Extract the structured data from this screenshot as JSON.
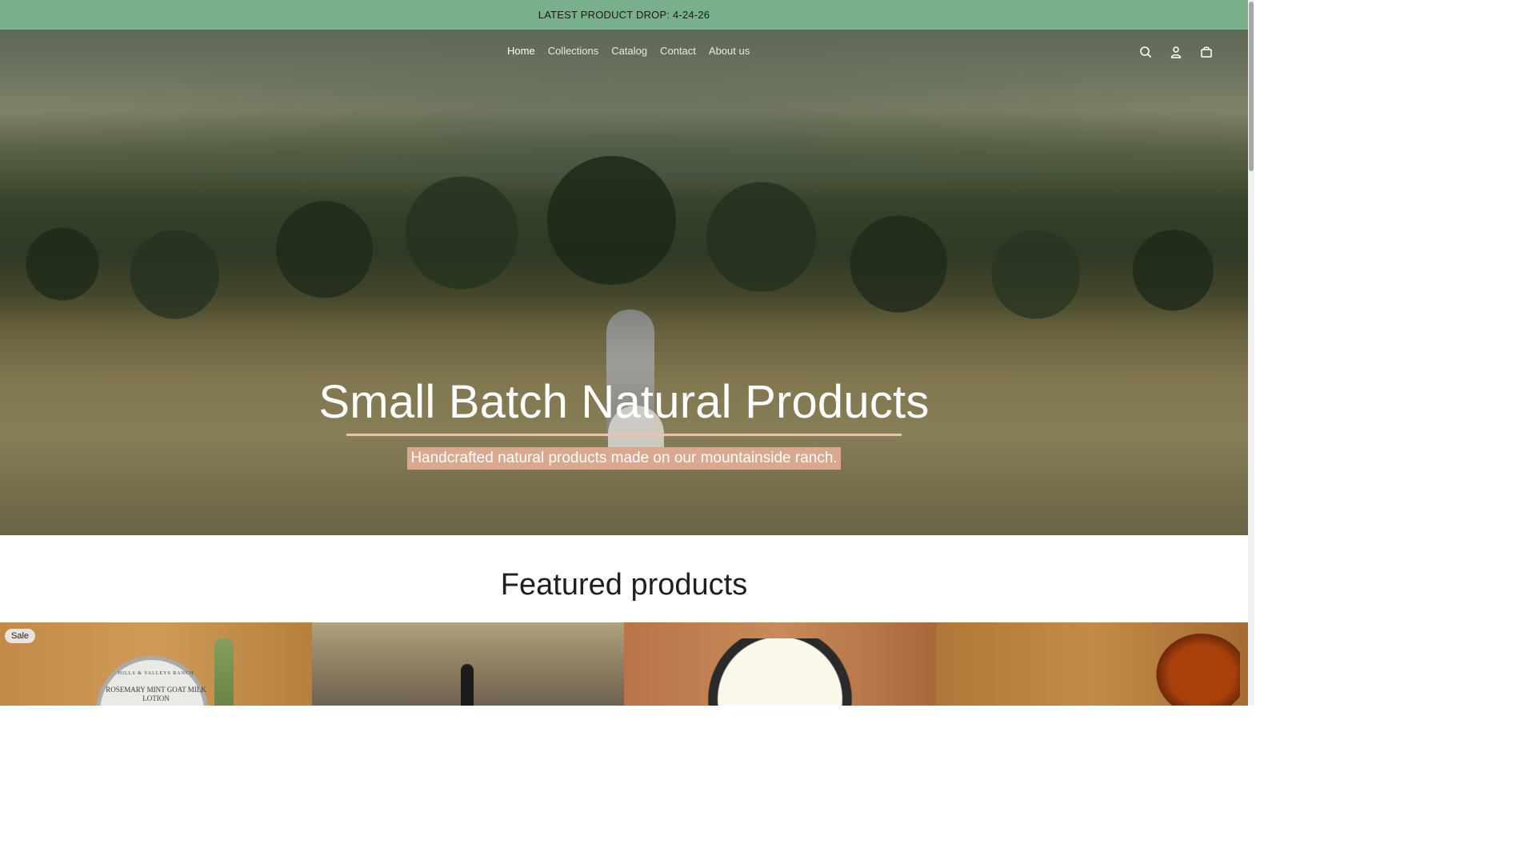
{
  "announcement": {
    "text": "LATEST PRODUCT DROP: 4-24-26"
  },
  "nav": {
    "items": [
      {
        "label": "Home",
        "active": true
      },
      {
        "label": "Collections",
        "active": false
      },
      {
        "label": "Catalog",
        "active": false
      },
      {
        "label": "Contact",
        "active": false
      },
      {
        "label": "About us",
        "active": false
      }
    ]
  },
  "header_icons": [
    "search-icon",
    "account-icon",
    "cart-icon"
  ],
  "hero": {
    "title": "Small Batch Natural Products",
    "subtitle": "Handcrafted natural products made on our mountainside ranch."
  },
  "featured": {
    "title": "Featured products",
    "products": [
      {
        "badge": "Sale",
        "label_small": "HILLS & VALLEYS RANCH",
        "label_main": "ROSEMARY MINT GOAT MILK LOTION"
      },
      {},
      {},
      {}
    ]
  },
  "colors": {
    "announcement_bg": "#79b08b",
    "hero_underline": "#e7c5b1",
    "subtitle_highlight": "#d9a88e"
  }
}
